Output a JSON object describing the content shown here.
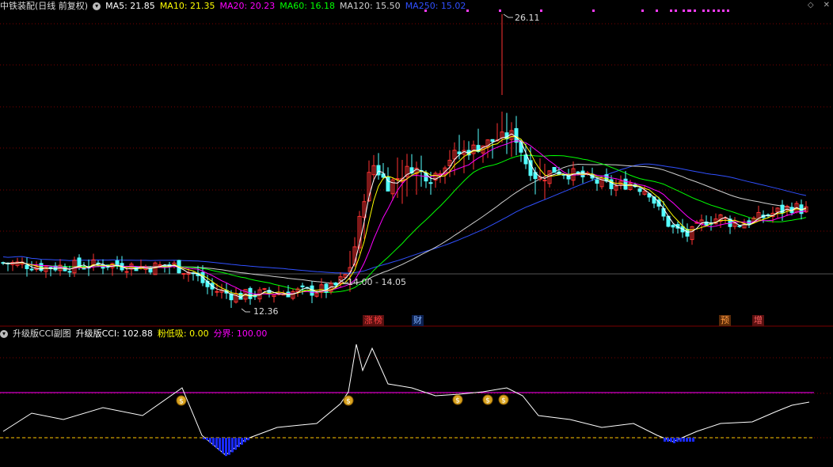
{
  "main_panel": {
    "stock_name": "中铁装配(日线 前复权)",
    "ma": [
      {
        "label": "MA5: 21.85",
        "color": "#ffffff"
      },
      {
        "label": "MA10: 21.35",
        "color": "#ffff00"
      },
      {
        "label": "MA20: 20.23",
        "color": "#ff00ff"
      },
      {
        "label": "MA60: 16.18",
        "color": "#00ff00"
      },
      {
        "label": "MA120: 15.50",
        "color": "#d0d0d0"
      },
      {
        "label": "MA250: 15.02",
        "color": "#3050ff"
      }
    ],
    "price_high": "26.11",
    "price_low": "12.36",
    "range_label": "14.00 - 14.05",
    "events": [
      {
        "text": "涨",
        "color": "#ff4040",
        "bg": "#5a1010"
      },
      {
        "text": "榜",
        "color": "#ff4040",
        "bg": "#5a1010"
      },
      {
        "text": "财",
        "color": "#7fb0ff",
        "bg": "#0c2050"
      },
      {
        "text": "预",
        "color": "#ff9a40",
        "bg": "#5a2a08"
      },
      {
        "text": "增",
        "color": "#ff6060",
        "bg": "#5a1010"
      }
    ]
  },
  "sub_panel": {
    "indicator_name": "升级版CCI副图",
    "values": [
      {
        "label": "升级版CCI: 102.88",
        "color": "#ffffff"
      },
      {
        "label": "粉低吸: 0.00",
        "color": "#ffff00"
      },
      {
        "label": "分界: 100.00",
        "color": "#ff00ff"
      }
    ]
  },
  "icons": [
    "settings-circle-icon",
    "diamond-icon",
    "close-icon"
  ],
  "colors": {
    "up": "#ff3232",
    "down": "#54ffff",
    "grid": "#7a0000"
  }
}
